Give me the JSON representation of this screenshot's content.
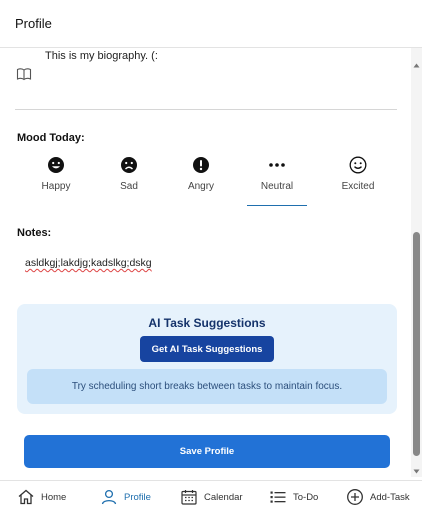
{
  "header": {
    "title": "Profile"
  },
  "bio": {
    "text": "This is my biography. (:",
    "icon": "book-icon"
  },
  "mood": {
    "label": "Mood Today:",
    "selected": "Neutral",
    "options": [
      {
        "label": "Happy",
        "icon": "happy-face-icon"
      },
      {
        "label": "Sad",
        "icon": "sad-face-icon"
      },
      {
        "label": "Angry",
        "icon": "exclamation-circle-icon"
      },
      {
        "label": "Neutral",
        "icon": "ellipsis-icon"
      },
      {
        "label": "Excited",
        "icon": "smile-outline-icon"
      }
    ]
  },
  "notes": {
    "label": "Notes:",
    "value": "asldkgj;lakdjg;kadslkg;dskg"
  },
  "ai": {
    "title": "AI Task Suggestions",
    "button_label": "Get AI Task Suggestions",
    "tip": "Try scheduling short breaks between tasks to maintain focus."
  },
  "save": {
    "label": "Save Profile"
  },
  "bottom_nav": {
    "active": "Profile",
    "items": [
      {
        "label": "Home",
        "icon": "home-icon"
      },
      {
        "label": "Profile",
        "icon": "user-icon"
      },
      {
        "label": "Calendar",
        "icon": "calendar-icon"
      },
      {
        "label": "To-Do",
        "icon": "list-icon"
      },
      {
        "label": "Add-Task",
        "icon": "plus-circle-icon"
      }
    ]
  },
  "colors": {
    "accent": "#1f6fae",
    "primary_button": "#2272d6",
    "ai_button": "#1744a0",
    "ai_card_bg": "#e6f2fc",
    "tip_bg": "#c4e0f8",
    "spellcheck": "#dd4444"
  }
}
